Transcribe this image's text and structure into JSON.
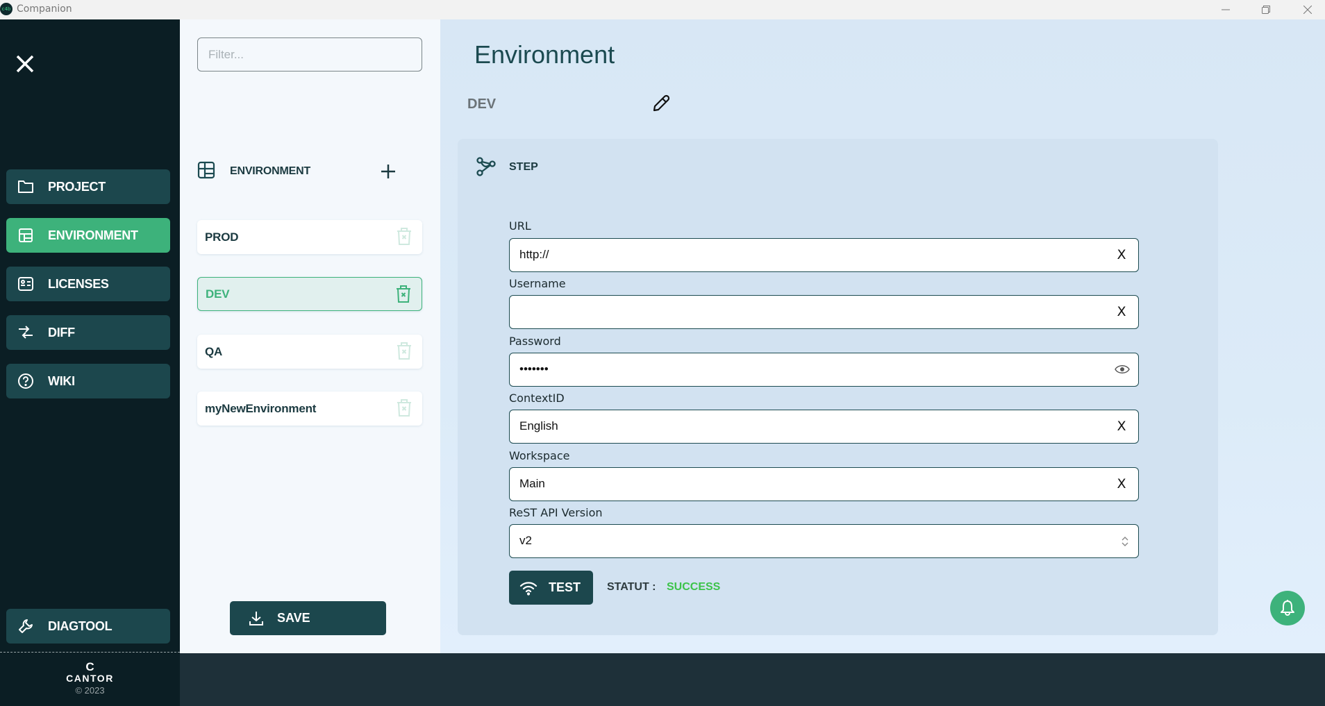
{
  "window": {
    "title": "Companion",
    "app_icon_text": "c4b"
  },
  "sidebar": {
    "nav": [
      {
        "label": "PROJECT",
        "icon": "folder-icon",
        "active": false
      },
      {
        "label": "ENVIRONMENT",
        "icon": "layout-icon",
        "active": true
      },
      {
        "label": "LICENSES",
        "icon": "id-card-icon",
        "active": false
      },
      {
        "label": "DIFF",
        "icon": "arrows-exchange-icon",
        "active": false
      },
      {
        "label": "WIKI",
        "icon": "help-circle-icon",
        "active": false
      }
    ],
    "diagtool_label": "DIAGTOOL",
    "logo": {
      "mark": "C",
      "brand": "CANTOR",
      "copyright": "© 2023"
    }
  },
  "list_panel": {
    "filter": {
      "value": "",
      "placeholder": "Filter..."
    },
    "header_label": "ENVIRONMENT",
    "items": [
      {
        "name": "PROD",
        "active": false
      },
      {
        "name": "DEV",
        "active": true
      },
      {
        "name": "QA",
        "active": false
      },
      {
        "name": "myNewEnvironment",
        "active": false
      }
    ],
    "save_label": "SAVE"
  },
  "main": {
    "title": "Environment",
    "env_name": "DEV",
    "card": {
      "section_label": "STEP",
      "fields": {
        "url": {
          "label": "URL",
          "value": "http://",
          "action": "X"
        },
        "username": {
          "label": "Username",
          "value": "",
          "action": "X"
        },
        "password": {
          "label": "Password",
          "value": "•••••••"
        },
        "context_id": {
          "label": "ContextID",
          "value": "English",
          "action": "X"
        },
        "workspace": {
          "label": "Workspace",
          "value": "Main",
          "action": "X"
        },
        "api_version": {
          "label": "ReST API Version",
          "value": "v2"
        }
      },
      "test_label": "TEST",
      "status_label": "STATUT :",
      "status_value": "SUCCESS",
      "status_color": "#3cc34a"
    }
  },
  "colors": {
    "accent": "#3db27b",
    "primary_dark": "#1c474d",
    "sidebar_bg": "#0b1e24"
  }
}
